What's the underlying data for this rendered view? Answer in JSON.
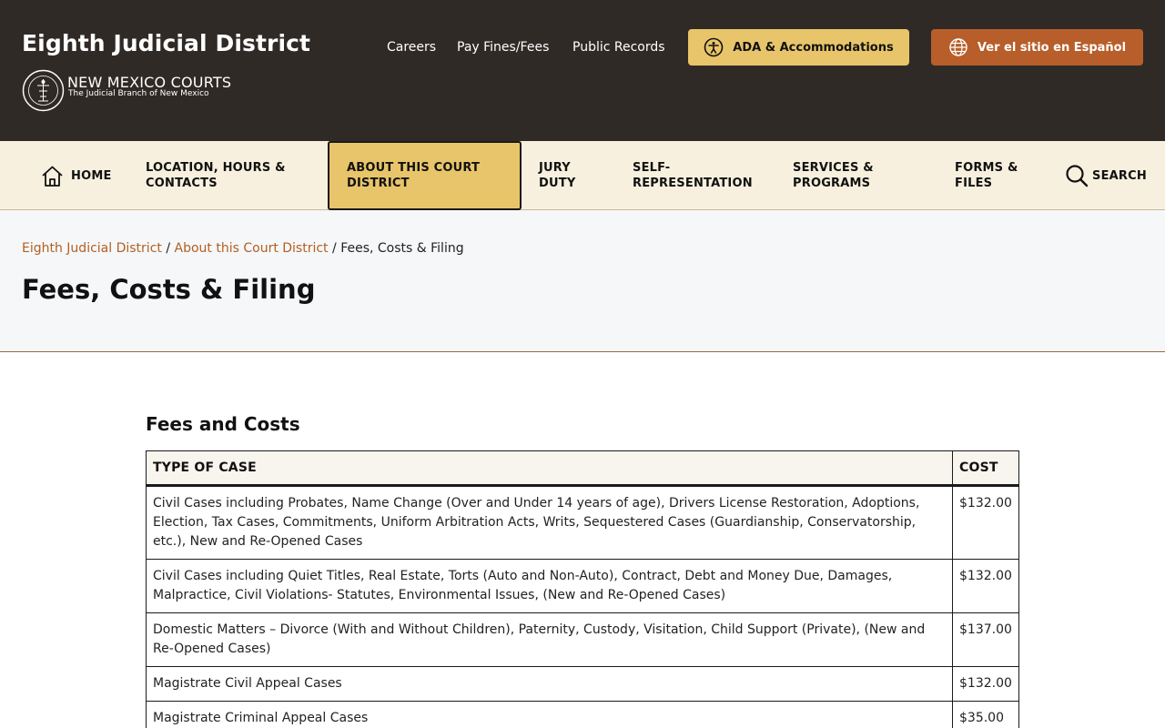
{
  "header": {
    "site_title": "Eighth Judicial District",
    "logo_main": "NEW MEXICO COURTS",
    "logo_sub": "The Judicial Branch of New Mexico",
    "links": [
      "Careers",
      "Pay Fines/Fees",
      "Public Records"
    ],
    "ada_label": "ADA & Accommodations",
    "spanish_label": "Ver el sitio en Español",
    "colors": {
      "bar": "#302a27",
      "ada": "#e8c56a",
      "spanish": "#b85e2a"
    }
  },
  "nav": {
    "home": "HOME",
    "location_1": "LOCATION, HOURS &",
    "location_2": "CONTACTS",
    "about_1": "ABOUT THIS COURT",
    "about_2": "DISTRICT",
    "jury_1": "JURY",
    "jury_2": "DUTY",
    "self_1": "SELF-",
    "self_2": "REPRESENTATION",
    "services_1": "SERVICES &",
    "services_2": "PROGRAMS",
    "forms_1": "FORMS &",
    "forms_2": "FILES",
    "search": "SEARCH",
    "active": "ABOUT THIS COURT DISTRICT"
  },
  "breadcrumb": {
    "item1": "Eighth Judicial District",
    "item2": "About this Court District",
    "current": "Fees, Costs & Filing",
    "sep": "/"
  },
  "page": {
    "title": "Fees, Costs & Filing",
    "section_title": "Fees and Costs"
  },
  "table": {
    "headers": {
      "type": "TYPE OF CASE",
      "cost": "COST"
    },
    "rows": [
      {
        "type": "Civil Cases including Probates, Name Change (Over and Under 14 years of age), Drivers License Restoration, Adoptions, Election, Tax Cases, Commitments, Uniform Arbitration Acts, Writs, Sequestered Cases (Guardianship, Conservatorship, etc.), New and Re-Opened Cases",
        "cost": "$132.00"
      },
      {
        "type": "Civil Cases including Quiet Titles, Real Estate, Torts (Auto and Non-Auto), Contract, Debt and Money Due, Damages, Malpractice, Civil Violations- Statutes, Environmental Issues, (New and Re-Opened Cases)",
        "cost": "$132.00"
      },
      {
        "type": "Domestic Matters – Divorce (With and Without Children), Paternity, Custody, Visitation, Child Support (Private), (New and Re-Opened Cases)",
        "cost": "$137.00"
      },
      {
        "type": "Magistrate Civil Appeal Cases",
        "cost": "$132.00"
      },
      {
        "type": "Magistrate Criminal Appeal Cases",
        "cost": "$35.00"
      }
    ]
  }
}
